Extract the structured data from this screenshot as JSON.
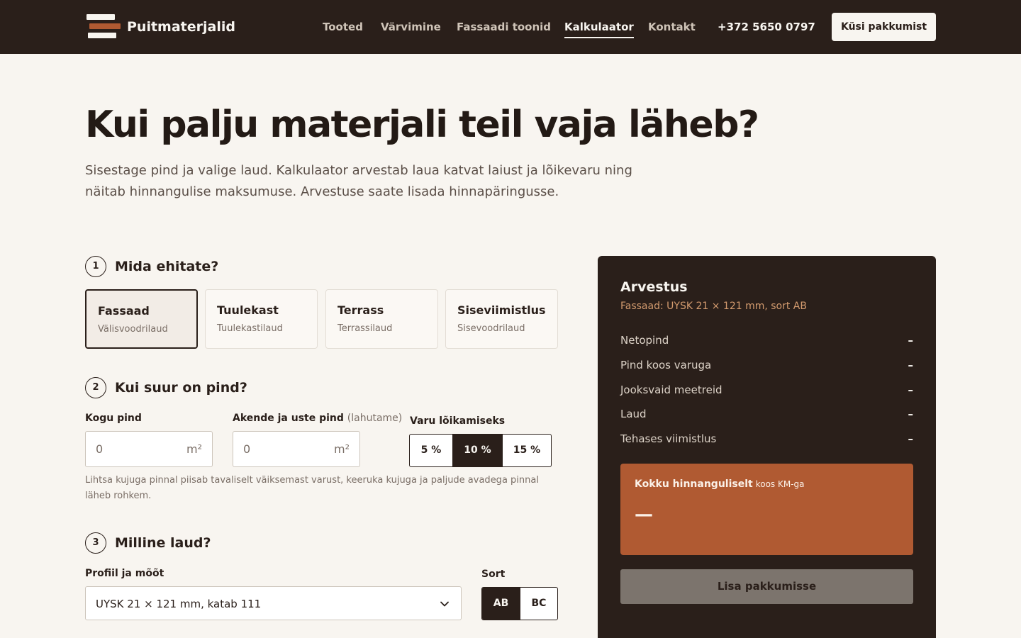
{
  "header": {
    "brand": "Puitmaterjalid",
    "nav": [
      "Tooted",
      "Värvimine",
      "Fassaadi toonid",
      "Kalkulaator",
      "Kontakt"
    ],
    "active_nav": "Kalkulaator",
    "phone": "+372 5650 0797",
    "cta": "Küsi pakkumist"
  },
  "hero": {
    "title": "Kui palju materjali teil vaja läheb?",
    "lead": "Sisestage pind ja valige laud. Kalkulaator arvestab laua katvat laiust ja lõikevaru ning näitab hinnangulise maksumuse. Arvestuse saate lisada hinnapäringusse."
  },
  "step1": {
    "num": "1",
    "title": "Mida ehitate?",
    "options": [
      {
        "title": "Fassaad",
        "sub": "Välisvoodrilaud",
        "selected": true
      },
      {
        "title": "Tuulekast",
        "sub": "Tuulekastilaud",
        "selected": false
      },
      {
        "title": "Terrass",
        "sub": "Terrassilaud",
        "selected": false
      },
      {
        "title": "Siseviimistlus",
        "sub": "Sisevoodrilaud",
        "selected": false
      }
    ]
  },
  "step2": {
    "num": "2",
    "title": "Kui suur on pind?",
    "total_label": "Kogu pind",
    "total_value": "0",
    "total_unit": "m²",
    "windows_label": "Akende ja uste pind",
    "windows_note": "(lahutame)",
    "windows_value": "0",
    "windows_unit": "m²",
    "waste_label": "Varu lõikamiseks",
    "waste_options": [
      "5 %",
      "10 %",
      "15 %"
    ],
    "waste_selected": "10 %",
    "help": "Lihtsa kujuga pinnal piisab tavaliselt väiksemast varust, keeruka kujuga ja paljude avadega pinnal läheb rohkem."
  },
  "step3": {
    "num": "3",
    "title": "Milline laud?",
    "profile_label": "Profiil ja mõõt",
    "profile_value": "UYSK 21 × 121 mm, katab 111",
    "grade_label": "Sort",
    "grade_options": [
      "AB",
      "BC"
    ],
    "grade_selected": "AB"
  },
  "summary": {
    "title": "Arvestus",
    "subtitle": "Fassaad: UYSK 21 × 121 mm, sort AB",
    "rows": [
      {
        "label": "Netopind",
        "value": "–"
      },
      {
        "label": "Pind koos varuga",
        "value": "–"
      },
      {
        "label": "Jooksvaid meetreid",
        "value": "–"
      },
      {
        "label": "Laud",
        "value": "–"
      },
      {
        "label": "Tehases viimistlus",
        "value": "–"
      }
    ],
    "total_label": "Kokku hinnanguliselt",
    "total_note": "koos KM-ga",
    "total_value": "—",
    "add_button": "Lisa pakkumisse"
  },
  "colors": {
    "dark": "#2a1f1a",
    "accent": "#b05a32",
    "background": "#f8f5f0"
  }
}
